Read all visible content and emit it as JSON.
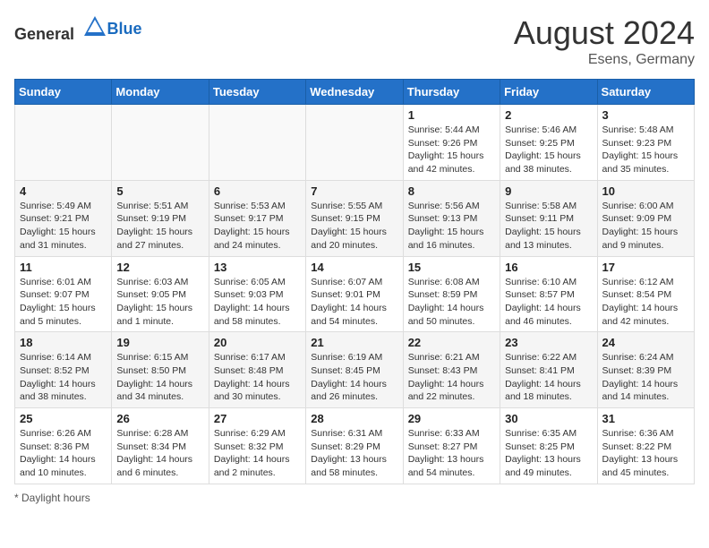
{
  "header": {
    "logo_general": "General",
    "logo_blue": "Blue",
    "month_year": "August 2024",
    "location": "Esens, Germany"
  },
  "days_of_week": [
    "Sunday",
    "Monday",
    "Tuesday",
    "Wednesday",
    "Thursday",
    "Friday",
    "Saturday"
  ],
  "footer": {
    "daylight_label": "Daylight hours"
  },
  "weeks": [
    [
      {
        "day": "",
        "info": ""
      },
      {
        "day": "",
        "info": ""
      },
      {
        "day": "",
        "info": ""
      },
      {
        "day": "",
        "info": ""
      },
      {
        "day": "1",
        "info": "Sunrise: 5:44 AM\nSunset: 9:26 PM\nDaylight: 15 hours\nand 42 minutes."
      },
      {
        "day": "2",
        "info": "Sunrise: 5:46 AM\nSunset: 9:25 PM\nDaylight: 15 hours\nand 38 minutes."
      },
      {
        "day": "3",
        "info": "Sunrise: 5:48 AM\nSunset: 9:23 PM\nDaylight: 15 hours\nand 35 minutes."
      }
    ],
    [
      {
        "day": "4",
        "info": "Sunrise: 5:49 AM\nSunset: 9:21 PM\nDaylight: 15 hours\nand 31 minutes."
      },
      {
        "day": "5",
        "info": "Sunrise: 5:51 AM\nSunset: 9:19 PM\nDaylight: 15 hours\nand 27 minutes."
      },
      {
        "day": "6",
        "info": "Sunrise: 5:53 AM\nSunset: 9:17 PM\nDaylight: 15 hours\nand 24 minutes."
      },
      {
        "day": "7",
        "info": "Sunrise: 5:55 AM\nSunset: 9:15 PM\nDaylight: 15 hours\nand 20 minutes."
      },
      {
        "day": "8",
        "info": "Sunrise: 5:56 AM\nSunset: 9:13 PM\nDaylight: 15 hours\nand 16 minutes."
      },
      {
        "day": "9",
        "info": "Sunrise: 5:58 AM\nSunset: 9:11 PM\nDaylight: 15 hours\nand 13 minutes."
      },
      {
        "day": "10",
        "info": "Sunrise: 6:00 AM\nSunset: 9:09 PM\nDaylight: 15 hours\nand 9 minutes."
      }
    ],
    [
      {
        "day": "11",
        "info": "Sunrise: 6:01 AM\nSunset: 9:07 PM\nDaylight: 15 hours\nand 5 minutes."
      },
      {
        "day": "12",
        "info": "Sunrise: 6:03 AM\nSunset: 9:05 PM\nDaylight: 15 hours\nand 1 minute."
      },
      {
        "day": "13",
        "info": "Sunrise: 6:05 AM\nSunset: 9:03 PM\nDaylight: 14 hours\nand 58 minutes."
      },
      {
        "day": "14",
        "info": "Sunrise: 6:07 AM\nSunset: 9:01 PM\nDaylight: 14 hours\nand 54 minutes."
      },
      {
        "day": "15",
        "info": "Sunrise: 6:08 AM\nSunset: 8:59 PM\nDaylight: 14 hours\nand 50 minutes."
      },
      {
        "day": "16",
        "info": "Sunrise: 6:10 AM\nSunset: 8:57 PM\nDaylight: 14 hours\nand 46 minutes."
      },
      {
        "day": "17",
        "info": "Sunrise: 6:12 AM\nSunset: 8:54 PM\nDaylight: 14 hours\nand 42 minutes."
      }
    ],
    [
      {
        "day": "18",
        "info": "Sunrise: 6:14 AM\nSunset: 8:52 PM\nDaylight: 14 hours\nand 38 minutes."
      },
      {
        "day": "19",
        "info": "Sunrise: 6:15 AM\nSunset: 8:50 PM\nDaylight: 14 hours\nand 34 minutes."
      },
      {
        "day": "20",
        "info": "Sunrise: 6:17 AM\nSunset: 8:48 PM\nDaylight: 14 hours\nand 30 minutes."
      },
      {
        "day": "21",
        "info": "Sunrise: 6:19 AM\nSunset: 8:45 PM\nDaylight: 14 hours\nand 26 minutes."
      },
      {
        "day": "22",
        "info": "Sunrise: 6:21 AM\nSunset: 8:43 PM\nDaylight: 14 hours\nand 22 minutes."
      },
      {
        "day": "23",
        "info": "Sunrise: 6:22 AM\nSunset: 8:41 PM\nDaylight: 14 hours\nand 18 minutes."
      },
      {
        "day": "24",
        "info": "Sunrise: 6:24 AM\nSunset: 8:39 PM\nDaylight: 14 hours\nand 14 minutes."
      }
    ],
    [
      {
        "day": "25",
        "info": "Sunrise: 6:26 AM\nSunset: 8:36 PM\nDaylight: 14 hours\nand 10 minutes."
      },
      {
        "day": "26",
        "info": "Sunrise: 6:28 AM\nSunset: 8:34 PM\nDaylight: 14 hours\nand 6 minutes."
      },
      {
        "day": "27",
        "info": "Sunrise: 6:29 AM\nSunset: 8:32 PM\nDaylight: 14 hours\nand 2 minutes."
      },
      {
        "day": "28",
        "info": "Sunrise: 6:31 AM\nSunset: 8:29 PM\nDaylight: 13 hours\nand 58 minutes."
      },
      {
        "day": "29",
        "info": "Sunrise: 6:33 AM\nSunset: 8:27 PM\nDaylight: 13 hours\nand 54 minutes."
      },
      {
        "day": "30",
        "info": "Sunrise: 6:35 AM\nSunset: 8:25 PM\nDaylight: 13 hours\nand 49 minutes."
      },
      {
        "day": "31",
        "info": "Sunrise: 6:36 AM\nSunset: 8:22 PM\nDaylight: 13 hours\nand 45 minutes."
      }
    ]
  ]
}
